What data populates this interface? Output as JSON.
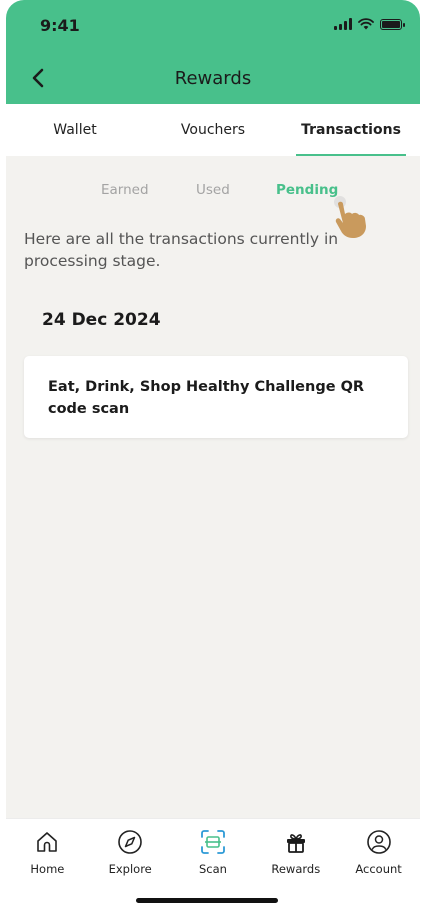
{
  "status_bar": {
    "time": "9:41"
  },
  "header": {
    "title": "Rewards"
  },
  "tabs": [
    {
      "label": "Wallet",
      "active": false
    },
    {
      "label": "Vouchers",
      "active": false
    },
    {
      "label": "Transactions",
      "active": true
    }
  ],
  "subtabs": [
    {
      "label": "Earned",
      "active": false
    },
    {
      "label": "Used",
      "active": false
    },
    {
      "label": "Pending",
      "active": true
    }
  ],
  "description": "Here are all the transactions currently in processing stage.",
  "transactions": [
    {
      "date": "24 Dec 2024",
      "items": [
        {
          "title": "Eat, Drink, Shop Healthy Challenge QR code scan"
        }
      ]
    }
  ],
  "bottom_nav": [
    {
      "label": "Home",
      "icon": "home-icon"
    },
    {
      "label": "Explore",
      "icon": "compass-icon"
    },
    {
      "label": "Scan",
      "icon": "scan-icon"
    },
    {
      "label": "Rewards",
      "icon": "gift-icon"
    },
    {
      "label": "Account",
      "icon": "user-icon"
    }
  ],
  "colors": {
    "brand": "#48c08b",
    "background": "#f3f2ef",
    "inactive_text": "#a3a3a3"
  }
}
